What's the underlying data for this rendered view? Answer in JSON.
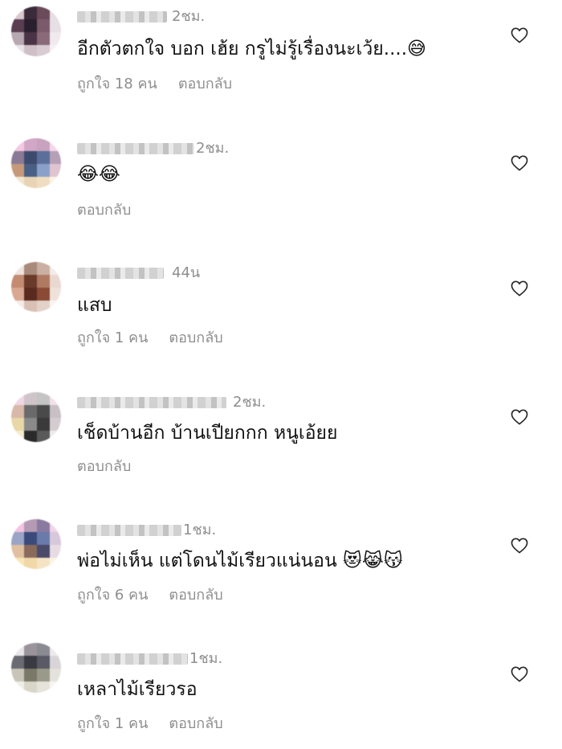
{
  "comments": [
    {
      "time": "2ชม.",
      "text": "อีกตัวตกใจ บอก เฮ้ย  กรูไม่รู้เรื่องนะเว้ย....😅",
      "likes": "ถูกใจ 18 คน",
      "reply": "ตอบกลับ",
      "avatar_colors": [
        "#d9c8cf",
        "#3b2a3a",
        "#6b4a5a",
        "#e8dde3",
        "#5a3e52",
        "#2a1f2e",
        "#7a5a6b",
        "#e6dfe4",
        "#b8a8b2",
        "#4a3344",
        "#8a6a78",
        "#f0eaee",
        "#e9e4e7",
        "#cfc0c8",
        "#d8ccd2",
        "#f5f2f4"
      ]
    },
    {
      "time": "2ชม.",
      "text": "😂😂",
      "likes": "",
      "reply": "ตอบกลับ",
      "avatar_colors": [
        "#f3c9e4",
        "#d1a6c6",
        "#c9a2bf",
        "#f5d7ea",
        "#8a7a95",
        "#3c4a6e",
        "#5c6f9a",
        "#b5a0b8",
        "#c49a7a",
        "#4a5f85",
        "#8aa0c8",
        "#e0c4cf",
        "#f1e6d0",
        "#e8d4b5",
        "#f0dcc0",
        "#fbf3e6"
      ]
    },
    {
      "time": "44น",
      "text": "แสบ",
      "likes": "ถูกใจ 1 คน",
      "reply": "ตอบกลับ",
      "avatar_colors": [
        "#efe3de",
        "#a88a7a",
        "#c9b0a2",
        "#f4ece8",
        "#c48a72",
        "#6a3a2a",
        "#b07a62",
        "#e8d8d0",
        "#d9a892",
        "#5a2a1e",
        "#8a4a36",
        "#f0e2da",
        "#f4ece8",
        "#d8c0b4",
        "#e4d2c8",
        "#faf5f2"
      ]
    },
    {
      "time": "2ชม.",
      "text": "เช็ดบ้านอีก บ้านเปียกกก หนูเอ้ยย",
      "likes": "",
      "reply": "ตอบกลับ",
      "avatar_colors": [
        "#f1d6e6",
        "#cfc5c9",
        "#c4c4c4",
        "#f4e0ea",
        "#d8b8a8",
        "#6a6a6a",
        "#4a4a4a",
        "#c8c0c4",
        "#e8d8a8",
        "#8a8a8a",
        "#3a3a3a",
        "#d4ccd0",
        "#f5ecd0",
        "#2a2a2a",
        "#5a5a5a",
        "#f0ecee"
      ]
    },
    {
      "time": "1ชม.",
      "text": "พ่อไม่เห็น แต่โดนไม้เรียวแน่นอน 😻😹😽",
      "likes": "ถูกใจ 6 คน",
      "reply": "ตอบกลับ",
      "avatar_colors": [
        "#f3c4e2",
        "#b49ab2",
        "#8a7aa0",
        "#f2d4e8",
        "#9aa4c4",
        "#3a4a7a",
        "#6a7aaa",
        "#d8c8dc",
        "#e0c0a0",
        "#8a6a5a",
        "#4a4a6a",
        "#e8dce4",
        "#f6e6b8",
        "#f0d8a8",
        "#f4e4c4",
        "#fbf4e4"
      ]
    },
    {
      "time": "1ชม.",
      "text": "เหลาไม้เรียวรอ",
      "likes": "ถูกใจ 1 คน",
      "reply": "ตอบกลับ",
      "avatar_colors": [
        "#e8e6e8",
        "#9a949a",
        "#8a8a92",
        "#eeeaec",
        "#6a6a72",
        "#3a3a42",
        "#5a5a66",
        "#d8d4d8",
        "#c8c4b8",
        "#7a7868",
        "#9a9a8a",
        "#e4e2dc",
        "#f0eee8",
        "#d8d6c8",
        "#e6e4da",
        "#f6f5f2"
      ]
    }
  ],
  "colors": {
    "text": "#111111",
    "meta": "#8e8e8e",
    "background": "#ffffff"
  },
  "icons": {
    "like": "heart-outline-icon"
  }
}
